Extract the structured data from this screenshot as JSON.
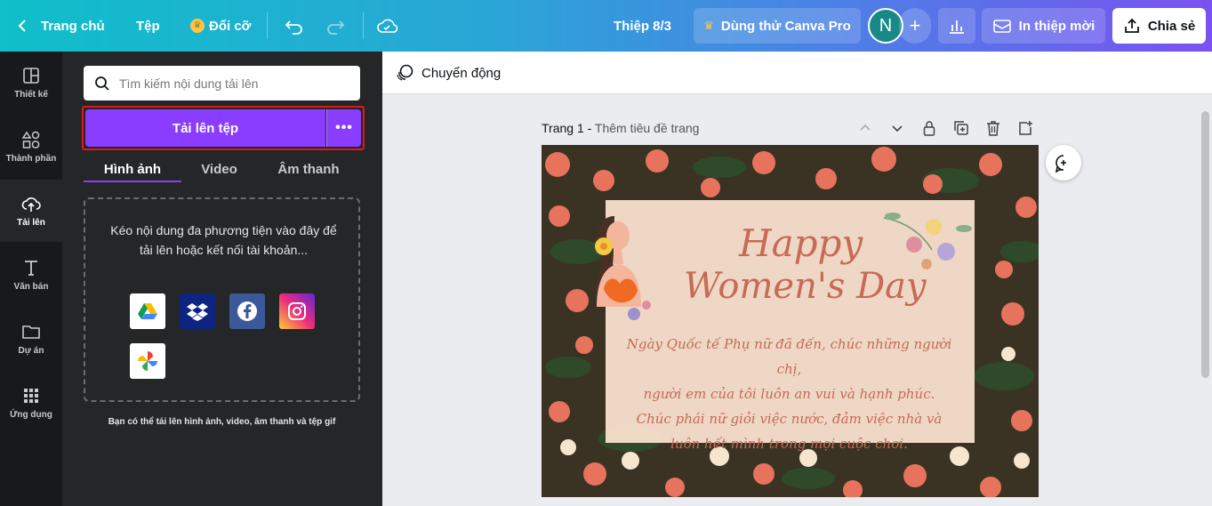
{
  "topbar": {
    "home_label": "Trang chủ",
    "file_label": "Tệp",
    "resize_label": "Đổi cỡ",
    "doc_title": "Thiệp 8/3",
    "pro_label": "Dùng thử Canva Pro",
    "avatar_initial": "N",
    "print_label": "In thiệp mời",
    "share_label": "Chia sẻ"
  },
  "rail": {
    "items": [
      {
        "label": "Thiết kế",
        "icon": "layout-icon"
      },
      {
        "label": "Thành phần",
        "icon": "shapes-icon"
      },
      {
        "label": "Tải lên",
        "icon": "cloud-upload-icon"
      },
      {
        "label": "Văn bản",
        "icon": "text-icon"
      },
      {
        "label": "Dự án",
        "icon": "folder-icon"
      },
      {
        "label": "Ứng dụng",
        "icon": "apps-grid-icon"
      }
    ]
  },
  "panel": {
    "search_placeholder": "Tìm kiếm nội dung tải lên",
    "upload_label": "Tải lên tệp",
    "more_label": "•••",
    "tabs": [
      "Hình ảnh",
      "Video",
      "Âm thanh"
    ],
    "dropzone_text": "Kéo nội dung đa phương tiện vào đây để tải lên hoặc kết nối tài khoản...",
    "services": [
      "google-drive-icon",
      "dropbox-icon",
      "facebook-icon",
      "instagram-icon",
      "google-photos-icon"
    ],
    "hint": "Bạn có thể tải lên hình ảnh, video, âm thanh và tệp gif"
  },
  "editor": {
    "motion_label": "Chuyển động",
    "page_label": "Trang 1 - ",
    "page_title_placeholder": "Thêm tiêu đề trang"
  },
  "card": {
    "title_line1": "Happy",
    "title_line2": "Women's Day",
    "message_lines": [
      "Ngày Quốc tế Phụ nữ đã đến, chúc những người chị,",
      "người em của tôi luôn an vui và hạnh phúc.",
      "Chúc phái nữ giỏi việc nước, đảm việc nhà và",
      "luôn hết mình trong mọi cuộc chơi."
    ]
  },
  "colors": {
    "accent": "#8b3dff",
    "highlight_border": "#e0171e",
    "panel_bg": "#252627",
    "rail_bg": "#18191b",
    "card_text": "#c76a56"
  }
}
